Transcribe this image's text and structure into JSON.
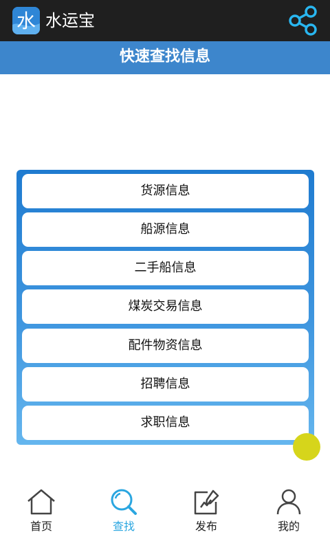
{
  "app": {
    "logo_char": "水",
    "title": "水运宝"
  },
  "page": {
    "title": "快速查找信息"
  },
  "menu": {
    "items": [
      {
        "label": "货源信息"
      },
      {
        "label": "船源信息"
      },
      {
        "label": "二手船信息"
      },
      {
        "label": "煤炭交易信息"
      },
      {
        "label": "配件物资信息"
      },
      {
        "label": "招聘信息"
      },
      {
        "label": "求职信息"
      }
    ]
  },
  "tabs": [
    {
      "label": "首页",
      "icon": "home-icon",
      "active": false
    },
    {
      "label": "查找",
      "icon": "search-icon",
      "active": true
    },
    {
      "label": "发布",
      "icon": "edit-icon",
      "active": false
    },
    {
      "label": "我的",
      "icon": "user-icon",
      "active": false
    }
  ],
  "colors": {
    "header": "#1f1f1f",
    "title_bar": "#3d86cc",
    "panel_top": "#1f7bd0",
    "panel_bottom": "#65b6ee",
    "accent": "#2aa6e0",
    "float_button": "#d6d51b"
  }
}
